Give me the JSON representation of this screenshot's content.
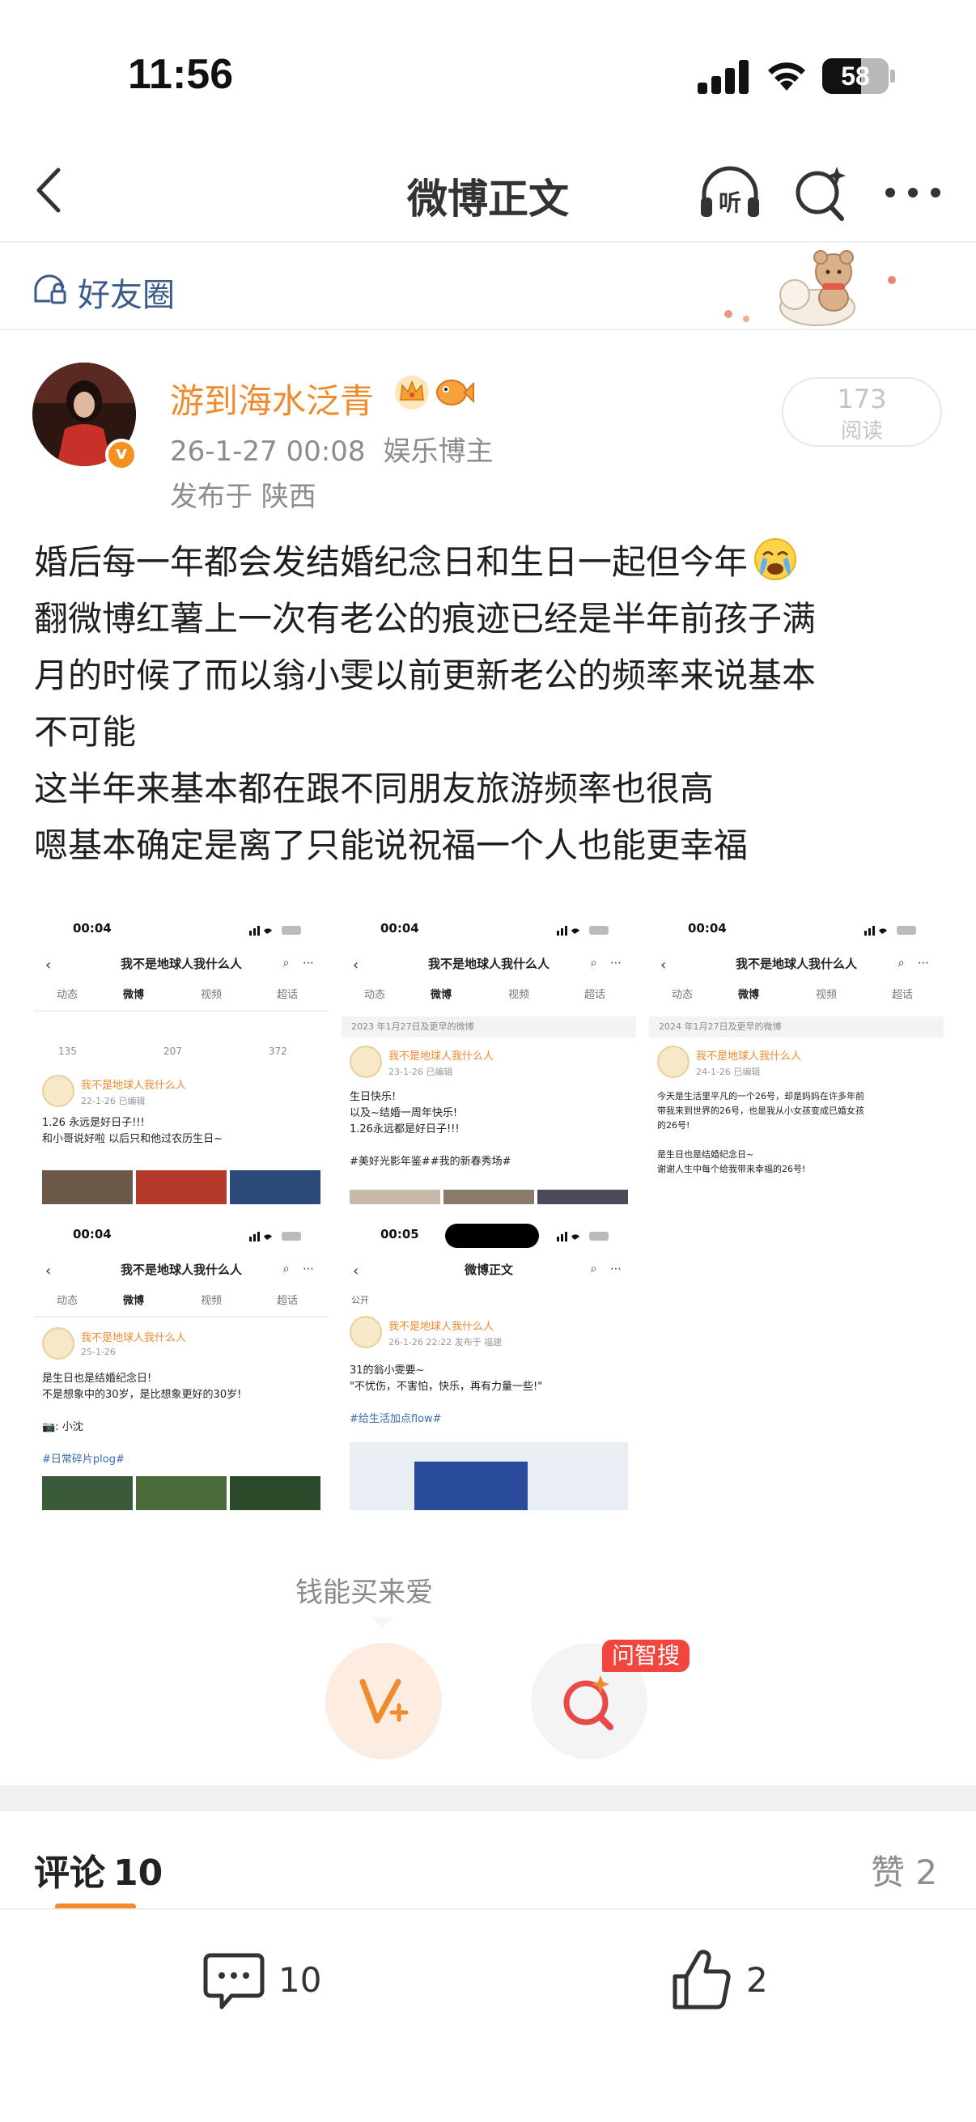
{
  "status_bar": {
    "time": "11:56",
    "battery": "58"
  },
  "nav": {
    "title": "微博正文",
    "listen_icon": "listen-icon",
    "search_icon": "search-icon",
    "more_icon": "more-icon"
  },
  "friend_circle": {
    "label": "好友圈"
  },
  "post": {
    "author": "游到海水泛青",
    "date": "26-1-27 00:08",
    "role": "娱乐博主",
    "location": "发布于 陕西",
    "reads_count": "173",
    "reads_label": "阅读",
    "lines": [
      "婚后每一年都会发结婚纪念日和生日一起但今年",
      "翻微博红薯上一次有老公的痕迹已经是半年前孩子满",
      "月的时候了而以翁小雯以前更新老公的频率来说基本",
      "不可能",
      "这半年来基本都在跟不同朋友旅游频率也很高",
      "嗯基本确定是离了只能说祝福一个人也能更幸福"
    ]
  },
  "thumbnails": [
    {
      "time": "00:04",
      "title": "我不是地球人我什么人",
      "bar": "",
      "user": "我不是地球人我什么人",
      "date": "22-1-26 已编辑",
      "body": [
        "1.26 永远是好日子!!!",
        "和小哥说好啦 以后只和他过农历生日~"
      ],
      "stats": [
        "135",
        "207",
        "372"
      ]
    },
    {
      "time": "00:04",
      "title": "我不是地球人我什么人",
      "bar": "2023 年1月27日及更早的微博",
      "user": "我不是地球人我什么人",
      "date": "23-1-26 已编辑",
      "body": [
        "生日快乐!",
        "以及~结婚一周年快乐!",
        "1.26永远都是好日子!!!",
        "",
        "#美好光影年鉴##我的新春秀场#"
      ],
      "stats": []
    },
    {
      "time": "00:04",
      "title": "我不是地球人我什么人",
      "bar": "2024 年1月27日及更早的微博",
      "user": "我不是地球人我什么人",
      "date": "24-1-26 已编辑",
      "body": [
        "今天是生活里平凡的一个26号，却是妈妈在许多年前",
        "带我来到世界的26号，也是我从小女孩变成已婚女孩",
        "的26号!",
        "",
        "是生日也是结婚纪念日~",
        "谢谢人生中每个给我带来幸福的26号!"
      ],
      "stats": []
    },
    {
      "time": "00:04",
      "title": "我不是地球人我什么人",
      "bar": "",
      "user": "我不是地球人我什么人",
      "date": "25-1-26",
      "body": [
        "是生日也是结婚纪念日!",
        "不是想象中的30岁，是比想象更好的30岁!",
        "",
        "📷: 小沈",
        "",
        "#日常碎片plog#"
      ],
      "stats": []
    },
    {
      "time": "00:05",
      "title": "微博正文",
      "bar": "公开",
      "user": "我不是地球人我什么人",
      "date": "26-1-26 22:22 发布于 福建",
      "body": [
        "31的翁小雯要~",
        "\"不忧伤，不害怕，快乐，再有力量一些!\"",
        "",
        "#给生活加点flow#"
      ],
      "stats": []
    }
  ],
  "thumb_tabs": [
    "动态",
    "微博",
    "视频",
    "超话"
  ],
  "reward": {
    "label": "钱能买来爱"
  },
  "search": {
    "badge": "问智搜"
  },
  "comments": {
    "label": "评论",
    "count": "10",
    "likes_label": "赞",
    "likes_count": "2"
  },
  "bottom": {
    "comment_count": "10",
    "like_count": "2"
  },
  "colors": {
    "accent": "#f08a2c",
    "link_blue": "#3a5a8c",
    "badge_red": "#f2453d"
  }
}
